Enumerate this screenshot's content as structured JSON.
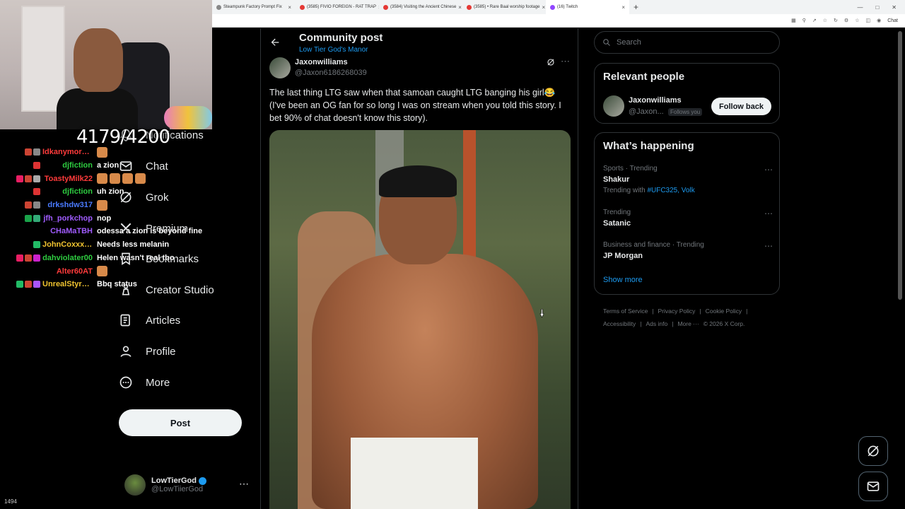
{
  "browser": {
    "tabs": [
      {
        "title": "Steampunk Factory Prompt Fix",
        "color": "#888888"
      },
      {
        "title": "(3585) FIVIO FOREIGN - RAT TRAP",
        "color": "#e53935"
      },
      {
        "title": "(3584) Visiting the Ancient Chinese",
        "color": "#e53935"
      },
      {
        "title": "(3585) • Rare Baal worship footage",
        "color": "#e53935"
      },
      {
        "title": "(16) Twitch",
        "color": "#9146ff"
      }
    ],
    "new_tab": "+",
    "chat_button": "Chat"
  },
  "stream": {
    "follower_goal": "4179/4200",
    "viewers": "1494"
  },
  "chat": [
    {
      "user": "Idkanymore_ciela",
      "color": "#ff3b3b",
      "badges": [
        "#c43",
        "#888"
      ],
      "message": "",
      "emotes": 1
    },
    {
      "user": "djfiction",
      "color": "#2ecc40",
      "badges": [
        "#d33"
      ],
      "message": "a zion",
      "emotes": 0
    },
    {
      "user": "ToastyMilk22",
      "color": "#ff3b3b",
      "badges": [
        "#e91e63",
        "#c43",
        "#aaa"
      ],
      "message": "",
      "emotes": 4
    },
    {
      "user": "djfiction",
      "color": "#2ecc40",
      "badges": [
        "#d33"
      ],
      "message": "uh zion",
      "emotes": 0
    },
    {
      "user": "drkshdw317",
      "color": "#4a7bff",
      "badges": [
        "#c43",
        "#888"
      ],
      "message": "",
      "emotes": 1
    },
    {
      "user": "jfh_porkchop",
      "color": "#a05cff",
      "badges": [
        "#1aa34a",
        "#3a7"
      ],
      "message": "nop",
      "emotes": 0
    },
    {
      "user": "CHaMaTBH",
      "color": "#a05cff",
      "badges": [],
      "message": "odessa a zion is beyond fine",
      "emotes": 0
    },
    {
      "user": "JohnCoxxx777",
      "color": "#f0c330",
      "badges": [
        "#2b6"
      ],
      "message": "Needs less melanin",
      "emotes": 0
    },
    {
      "user": "dahviolater00",
      "color": "#2ecc40",
      "badges": [
        "#e91e63",
        "#c43",
        "#c2c"
      ],
      "message": "Helen wasn't real tho",
      "emotes": 0
    },
    {
      "user": "Alter60AT",
      "color": "#ff3b3b",
      "badges": [],
      "message": "",
      "emotes": 1
    },
    {
      "user": "UnrealStyrofo...",
      "color": "#f0c330",
      "badges": [
        "#2b6",
        "#c43",
        "#a5f"
      ],
      "message": "Bbq status",
      "emotes": 0
    }
  ],
  "nav": {
    "items": [
      {
        "label": "Notifications",
        "icon": "bell-icon"
      },
      {
        "label": "Chat",
        "icon": "mail-icon"
      },
      {
        "label": "Grok",
        "icon": "grok-icon"
      },
      {
        "label": "Premium",
        "icon": "x-logo-icon"
      },
      {
        "label": "Bookmarks",
        "icon": "bookmark-icon"
      },
      {
        "label": "Creator Studio",
        "icon": "creator-icon"
      },
      {
        "label": "Articles",
        "icon": "article-icon"
      },
      {
        "label": "Profile",
        "icon": "profile-icon"
      },
      {
        "label": "More",
        "icon": "more-circle-icon"
      }
    ],
    "post_label": "Post",
    "account": {
      "name": "LowTierGod",
      "handle": "@LowTiierGod",
      "more": "⋯"
    }
  },
  "header": {
    "title": "Community post",
    "community": "Low Tier God's Manor"
  },
  "tweet": {
    "author": "Jaxonwilliams",
    "handle": "@Jaxon6186268039",
    "more": "⋯",
    "text": "The last thing LTG saw when that samoan caught LTG banging his girl😂 (I've been an OG fan for so long I was on stream when you told this story. I bet 90% of chat doesn't know this story)."
  },
  "sidebar": {
    "search_placeholder": "Search",
    "relevant": {
      "title": "Relevant people",
      "name": "Jaxonwilliams",
      "handle": "@Jaxon...",
      "follows_you": "Follows you",
      "follow_label": "Follow back"
    },
    "happening": {
      "title": "What’s happening",
      "trends": [
        {
          "context": "Sports · Trending",
          "title": "Shakur",
          "with_prefix": "Trending with ",
          "with_tags": "#UFC325, Volk"
        },
        {
          "context": "Trending",
          "title": "Satanic",
          "with_prefix": "",
          "with_tags": ""
        },
        {
          "context": "Business and finance · Trending",
          "title": "JP Morgan",
          "with_prefix": "",
          "with_tags": ""
        }
      ],
      "show_more": "Show more"
    },
    "footer": [
      "Terms of Service",
      "Privacy Policy",
      "Cookie Policy",
      "Accessibility",
      "Ads info",
      "More ···",
      "© 2026 X Corp."
    ]
  }
}
